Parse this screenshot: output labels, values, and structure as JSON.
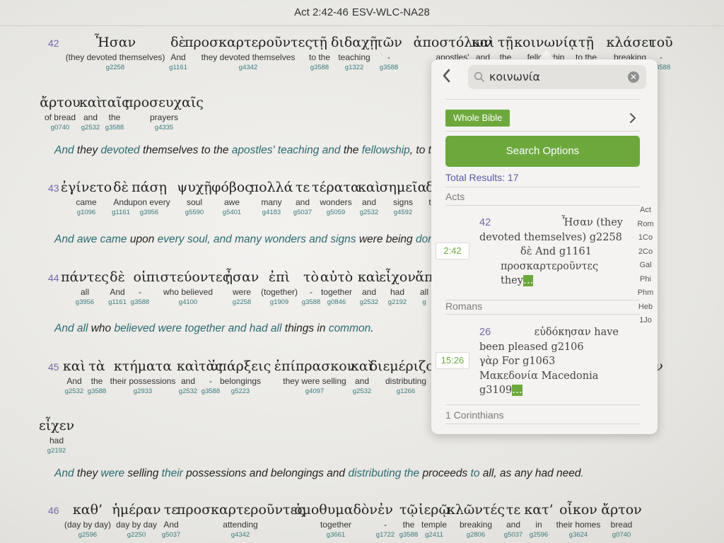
{
  "header": {
    "reference": "Act 2:42-46",
    "version": "ESV-WLC-NA28"
  },
  "verses": [
    {
      "num": "42",
      "lines": [
        [
          {
            "gk": "Ἦσαν",
            "en": "(they devoted themselves)",
            "sn": "g2258"
          },
          {
            "gk": "δὲ",
            "en": "And",
            "sn": "g1161"
          },
          {
            "gk": "προσκαρτεροῦντες",
            "en": "they devoted themselves",
            "sn": "g4342"
          },
          {
            "gk": "τῇ",
            "en": "to the",
            "sn": "g3588"
          },
          {
            "gk": "διδαχῇ",
            "en": "teaching",
            "sn": "g1322"
          },
          {
            "gk": "τῶν",
            "en": "-",
            "sn": "g3588"
          },
          {
            "gk": "ἀποστόλων",
            "en": "apostles'",
            "sn": ""
          },
          {
            "gk": "καὶ",
            "en": "and",
            "sn": ""
          },
          {
            "gk": "τῇ",
            "en": "the",
            "sn": ""
          },
          {
            "gk": "κοινωνίᾳ",
            "en": "fellowship",
            "sn": ""
          },
          {
            "gk": "τῇ",
            "en": "to the",
            "sn": ""
          },
          {
            "gk": "κλάσει",
            "en": "breaking",
            "sn": ""
          },
          {
            "gk": "τοῦ",
            "en": "-",
            "sn": "g3588"
          }
        ],
        [
          {
            "gk": "ἄρτου",
            "en": "of bread",
            "sn": "g0740"
          },
          {
            "gk": "καὶ",
            "en": "and",
            "sn": "g2532"
          },
          {
            "gk": "ταῖς",
            "en": "the",
            "sn": "g3588"
          },
          {
            "gk": "προσευχαῖς",
            "en": "prayers",
            "sn": "g4335"
          }
        ]
      ],
      "translation": [
        "And ",
        "they ",
        "devoted",
        " themselves to the ",
        "apostles' teaching and",
        " the ",
        "fellowship",
        ", to t"
      ]
    },
    {
      "num": "43",
      "lines": [
        [
          {
            "gk": "ἐγίνετο",
            "en": "came",
            "sn": "g1096"
          },
          {
            "gk": "δὲ",
            "en": "And",
            "sn": "g1161"
          },
          {
            "gk": "πάσῃ",
            "en": "upon every",
            "sn": "g3956"
          },
          {
            "gk": "ψυχῇ",
            "en": "soul",
            "sn": "g5590"
          },
          {
            "gk": "φόβος",
            "en": "awe",
            "sn": "g5401"
          },
          {
            "gk": "πολλά",
            "en": "many",
            "sn": "g4183"
          },
          {
            "gk": "τε",
            "en": "and",
            "sn": "g5037"
          },
          {
            "gk": "τέρατα",
            "en": "wonders",
            "sn": "g5059"
          },
          {
            "gk": "καὶ",
            "en": "and",
            "sn": "g2532"
          },
          {
            "gk": "σημεῖα",
            "en": "signs",
            "sn": "g4592"
          },
          {
            "gk": "δ",
            "en": "t",
            "sn": ""
          }
        ]
      ],
      "translation": [
        "And awe came",
        " upon ",
        "every soul, and many wonders and signs",
        " were being ",
        "don"
      ]
    },
    {
      "num": "44",
      "lines": [
        [
          {
            "gk": "πάντες",
            "en": "all",
            "sn": "g3956"
          },
          {
            "gk": "δὲ",
            "en": "And",
            "sn": "g1161"
          },
          {
            "gk": "οἱ",
            "en": "-",
            "sn": "g3588"
          },
          {
            "gk": "πιστεύοντες",
            "en": "who believed",
            "sn": "g4100"
          },
          {
            "gk": "ἦσαν",
            "en": "were",
            "sn": "g2258"
          },
          {
            "gk": "ἐπὶ",
            "en": "(together)",
            "sn": "g1909"
          },
          {
            "gk": "τὸ",
            "en": "-",
            "sn": "g3588"
          },
          {
            "gk": "αὐτὸ",
            "en": "together",
            "sn": "g0846"
          },
          {
            "gk": "καὶ",
            "en": "and",
            "sn": "g2532"
          },
          {
            "gk": "εἶχον",
            "en": "had",
            "sn": "g2192"
          },
          {
            "gk": "ἅπ",
            "en": "all",
            "sn": "g"
          }
        ]
      ],
      "translation": [
        "And all",
        " who ",
        "believed were together and had all",
        " things in ",
        "common",
        "."
      ]
    },
    {
      "num": "45",
      "lines": [
        [
          {
            "gk": "καὶ",
            "en": "And",
            "sn": "g2532"
          },
          {
            "gk": "τὰ",
            "en": "the",
            "sn": "g3588"
          },
          {
            "gk": "κτήματα",
            "en": "their possessions",
            "sn": "g2933"
          },
          {
            "gk": "καὶ",
            "en": "and",
            "sn": "g2532"
          },
          {
            "gk": "τὰς",
            "en": "-",
            "sn": "g3588"
          },
          {
            "gk": "ὑπάρξεις",
            "en": "belongings",
            "sn": "g5223"
          },
          {
            "gk": "ἐπίπρασκον",
            "en": "they were selling",
            "sn": "g4097"
          },
          {
            "gk": "καὶ",
            "en": "and",
            "sn": "g2532"
          },
          {
            "gk": "διεμέριζον",
            "en": "distributing",
            "sn": "g1266"
          }
        ],
        [
          {
            "gk": "εἶχεν",
            "en": "had",
            "sn": "g2192"
          }
        ]
      ],
      "translation": [
        "And ",
        "they ",
        "were ",
        "selling",
        " their ",
        "possessions and belongings and",
        " distributing the ",
        "proceeds",
        " to ",
        "all, as any had need",
        "."
      ]
    },
    {
      "num": "46",
      "lines": [
        [
          {
            "gk": "καθ’",
            "en": "(day by day)",
            "sn": "g2596"
          },
          {
            "gk": "ἡμέραν",
            "en": "day by day",
            "sn": "g2250"
          },
          {
            "gk": "τε",
            "en": "And",
            "sn": "g5037"
          },
          {
            "gk": "προσκαρτεροῦντες",
            "en": "attending",
            "sn": "g4342"
          },
          {
            "gk": "ὁμοθυμαδὸν",
            "en": "together",
            "sn": "g3661"
          },
          {
            "gk": "ἐν",
            "en": "-",
            "sn": "g1722"
          },
          {
            "gk": "τῷ",
            "en": "the",
            "sn": "g3588"
          },
          {
            "gk": "ἱερῷ",
            "en": "temple",
            "sn": "g2411"
          },
          {
            "gk": "κλῶντές",
            "en": "breaking",
            "sn": "g2806"
          },
          {
            "gk": "τε",
            "en": "and",
            "sn": "g5037"
          },
          {
            "gk": "κατ’",
            "en": "in",
            "sn": "g2596"
          },
          {
            "gk": "οἶκον",
            "en": "their homes",
            "sn": "g3624"
          },
          {
            "gk": "ἄρτον",
            "en": "bread",
            "sn": "g0740"
          }
        ]
      ]
    }
  ],
  "v45_extra": {
    "gk": "ν",
    "sn": ""
  },
  "search": {
    "query": "κοινωνία",
    "scope": "Whole Bible",
    "options_label": "Search Options",
    "total": "Total Results: 17",
    "sections": [
      {
        "book": "Acts",
        "ref": "2:42",
        "vnum": "42",
        "lines": [
          "Ἦσαν (they",
          "devoted themselves) g2258",
          "δὲ And g1161",
          "προσκαρτεροῦντες they"
        ]
      },
      {
        "book": "Romans",
        "ref": "15:26",
        "vnum": "26",
        "lines": [
          "εὐδόκησαν have",
          "been pleased g2106",
          "γὰρ For g1063",
          "Μακεδονία Macedonia g3109"
        ]
      },
      {
        "book": "1 Corinthians"
      }
    ],
    "ellipsis": "…",
    "index": [
      "Act",
      "Rom",
      "1Co",
      "2Co",
      "Gal",
      "Phi",
      "Phm",
      "Heb",
      "1Jo"
    ]
  },
  "colors": {
    "accent_green": "#6da83d",
    "verse_num": "#7467a8",
    "strong": "#3a7a7a"
  }
}
